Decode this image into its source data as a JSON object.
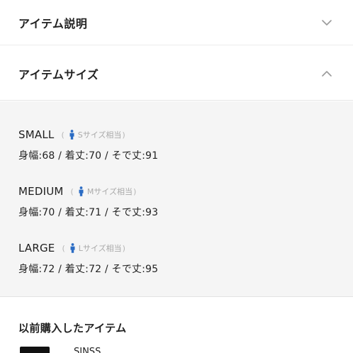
{
  "accordions": {
    "description": {
      "label": "アイテム説明",
      "state": "collapsed",
      "icon": "chevron-down-icon"
    },
    "sizes": {
      "label": "アイテムサイズ",
      "state": "expanded",
      "icon": "chevron-up-icon"
    }
  },
  "sizes": [
    {
      "name": "SMALL",
      "paren_open": "(",
      "equivalent": "Sサイズ相当",
      "paren_close": ")",
      "measurements": "身幅:68 / 着丈:70 / そで丈:91"
    },
    {
      "name": "MEDIUM",
      "paren_open": "(",
      "equivalent": "Mサイズ相当",
      "paren_close": ")",
      "measurements": "身幅:70 / 着丈:71 / そで丈:93"
    },
    {
      "name": "LARGE",
      "paren_open": "(",
      "equivalent": "Lサイズ相当",
      "paren_close": ")",
      "measurements": "身幅:72 / 着丈:72 / そで丈:95"
    }
  ],
  "previous": {
    "title": "以前購入したアイテム",
    "brand": "SINSS"
  },
  "colors": {
    "accent_blue": "#2b6cc4",
    "panel_bg": "#f5f5f5",
    "chevron_gray": "#9a9a9a"
  }
}
